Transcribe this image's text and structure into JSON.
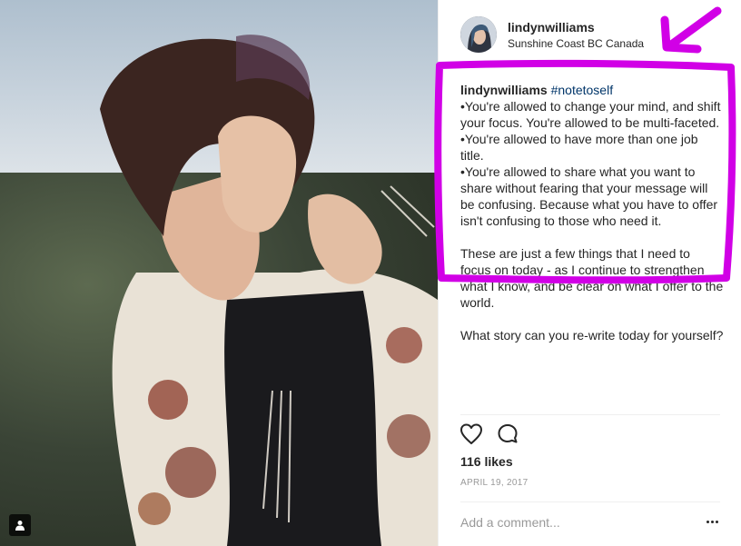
{
  "post": {
    "username": "lindynwilliams",
    "location": "Sunshine Coast BC Canada",
    "caption": {
      "author": "lindynwilliams",
      "hashtag": "#notetoself",
      "body": "\n•You're allowed to change your mind, and shift your focus. You're allowed to be multi-faceted.\n•You're allowed to have more than one job title.\n•You're allowed to share what you want to share without fearing that your message will be confusing. Because what you have to offer isn't confusing to those who need it.\n\nThese are just a few things that I need to focus on today - as I continue to strengthen what I know, and be clear on what I offer to the world.\n\nWhat story can you re-write today for yourself?"
    },
    "likes": "116 likes",
    "date": "APRIL 19, 2017"
  },
  "comment": {
    "placeholder": "Add a comment..."
  },
  "icons": {
    "like": "heart-icon",
    "comment": "comment-bubble-icon",
    "more": "more-options-icon",
    "user_tag": "user-tag-icon"
  },
  "colors": {
    "annotation": "#d100e6",
    "hashtag": "#003569",
    "text": "#262626",
    "muted": "#999999"
  }
}
